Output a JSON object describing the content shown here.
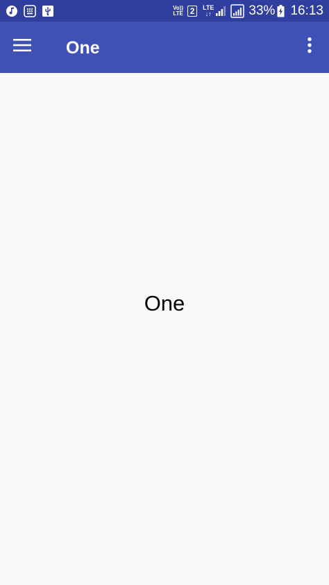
{
  "status_bar": {
    "left_icons": [
      "music-note-icon",
      "keypad-notification-icon",
      "usb-icon"
    ],
    "volte_top": "Vo))",
    "volte_bottom": "LTE",
    "sim_slot": "2",
    "lte_label": "LTE",
    "lte_arrows": "↓↑",
    "battery_percent": "33%",
    "time": "16:13"
  },
  "app_bar": {
    "title": "One",
    "menu_icon": "hamburger-menu-icon",
    "overflow_icon": "more-vertical-icon"
  },
  "main": {
    "text": "One"
  },
  "colors": {
    "status_bar": "#303f9f",
    "primary": "#3f51b5",
    "background": "#fafafa",
    "on_primary": "#ffffff",
    "text": "#000000"
  }
}
